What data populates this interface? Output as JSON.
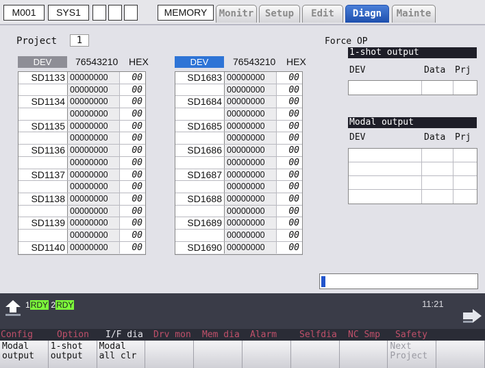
{
  "top_bar": {
    "program": "M001",
    "system": "SYS1",
    "mode": "MEMORY",
    "tabs": [
      {
        "label": "Monitr",
        "active": false
      },
      {
        "label": "Setup",
        "active": false
      },
      {
        "label": "Edit",
        "active": false
      },
      {
        "label": "Diagn",
        "active": true
      },
      {
        "label": "Mainte",
        "active": false
      }
    ]
  },
  "project": {
    "label": "Project",
    "value": "1"
  },
  "table_left": {
    "dev_header": "DEV",
    "bits_header": "76543210",
    "hex_header": "HEX",
    "rows": [
      {
        "dev": "SD1133",
        "bits": "00000000",
        "hex": "00"
      },
      {
        "dev": "",
        "bits": "00000000",
        "hex": "00"
      },
      {
        "dev": "SD1134",
        "bits": "00000000",
        "hex": "00"
      },
      {
        "dev": "",
        "bits": "00000000",
        "hex": "00"
      },
      {
        "dev": "SD1135",
        "bits": "00000000",
        "hex": "00"
      },
      {
        "dev": "",
        "bits": "00000000",
        "hex": "00"
      },
      {
        "dev": "SD1136",
        "bits": "00000000",
        "hex": "00"
      },
      {
        "dev": "",
        "bits": "00000000",
        "hex": "00"
      },
      {
        "dev": "SD1137",
        "bits": "00000000",
        "hex": "00"
      },
      {
        "dev": "",
        "bits": "00000000",
        "hex": "00"
      },
      {
        "dev": "SD1138",
        "bits": "00000000",
        "hex": "00"
      },
      {
        "dev": "",
        "bits": "00000000",
        "hex": "00"
      },
      {
        "dev": "SD1139",
        "bits": "00000000",
        "hex": "00"
      },
      {
        "dev": "",
        "bits": "00000000",
        "hex": "00"
      },
      {
        "dev": "SD1140",
        "bits": "00000000",
        "hex": "00"
      }
    ]
  },
  "table_right": {
    "dev_header": "DEV",
    "bits_header": "76543210",
    "hex_header": "HEX",
    "rows": [
      {
        "dev": "SD1683",
        "bits": "00000000",
        "hex": "00"
      },
      {
        "dev": "",
        "bits": "00000000",
        "hex": "00"
      },
      {
        "dev": "SD1684",
        "bits": "00000000",
        "hex": "00"
      },
      {
        "dev": "",
        "bits": "00000000",
        "hex": "00"
      },
      {
        "dev": "SD1685",
        "bits": "00000000",
        "hex": "00"
      },
      {
        "dev": "",
        "bits": "00000000",
        "hex": "00"
      },
      {
        "dev": "SD1686",
        "bits": "00000000",
        "hex": "00"
      },
      {
        "dev": "",
        "bits": "00000000",
        "hex": "00"
      },
      {
        "dev": "SD1687",
        "bits": "00000000",
        "hex": "00"
      },
      {
        "dev": "",
        "bits": "00000000",
        "hex": "00"
      },
      {
        "dev": "SD1688",
        "bits": "00000000",
        "hex": "00"
      },
      {
        "dev": "",
        "bits": "00000000",
        "hex": "00"
      },
      {
        "dev": "SD1689",
        "bits": "00000000",
        "hex": "00"
      },
      {
        "dev": "",
        "bits": "00000000",
        "hex": "00"
      },
      {
        "dev": "SD1690",
        "bits": "00000000",
        "hex": "00"
      }
    ]
  },
  "force_op": {
    "title": "Force OP",
    "one_shot": {
      "title": "1-shot output",
      "col_dev": "DEV",
      "col_data": "Data",
      "col_prj": "Prj",
      "row_count": 1
    },
    "modal": {
      "title": "Modal output",
      "col_dev": "DEV",
      "col_data": "Data",
      "col_prj": "Prj",
      "row_count": 4
    }
  },
  "status_bar": {
    "rdy1_num": "1",
    "rdy1": "RDY",
    "rdy2_num": "2",
    "rdy2": "RDY",
    "time": "11:21",
    "rdy_color": "#7cfc3a"
  },
  "function_menu": [
    {
      "label": "Config",
      "color": "#c0506a"
    },
    {
      "label": "Option",
      "color": "#c0506a"
    },
    {
      "label": "I/F dia",
      "color": "#e8e8ee"
    },
    {
      "label": "Drv mon",
      "color": "#c0506a"
    },
    {
      "label": "Mem dia",
      "color": "#c0506a"
    },
    {
      "label": "Alarm",
      "color": "#c0506a"
    },
    {
      "label": "Selfdia",
      "color": "#c0506a"
    },
    {
      "label": "NC Smp",
      "color": "#c0506a"
    },
    {
      "label": "Safety",
      "color": "#c0506a"
    }
  ],
  "softkeys": [
    {
      "line1": "Modal",
      "line2": "output",
      "enabled": true
    },
    {
      "line1": "1-shot",
      "line2": "output",
      "enabled": true
    },
    {
      "line1": "Modal",
      "line2": "all clr",
      "enabled": true
    },
    {
      "line1": "",
      "line2": "",
      "enabled": true
    },
    {
      "line1": "",
      "line2": "",
      "enabled": true
    },
    {
      "line1": "",
      "line2": "",
      "enabled": true
    },
    {
      "line1": "",
      "line2": "",
      "enabled": true
    },
    {
      "line1": "",
      "line2": "",
      "enabled": true
    },
    {
      "line1": "Next",
      "line2": "Project",
      "enabled": false
    },
    {
      "line1": "",
      "line2": "",
      "enabled": true
    }
  ]
}
